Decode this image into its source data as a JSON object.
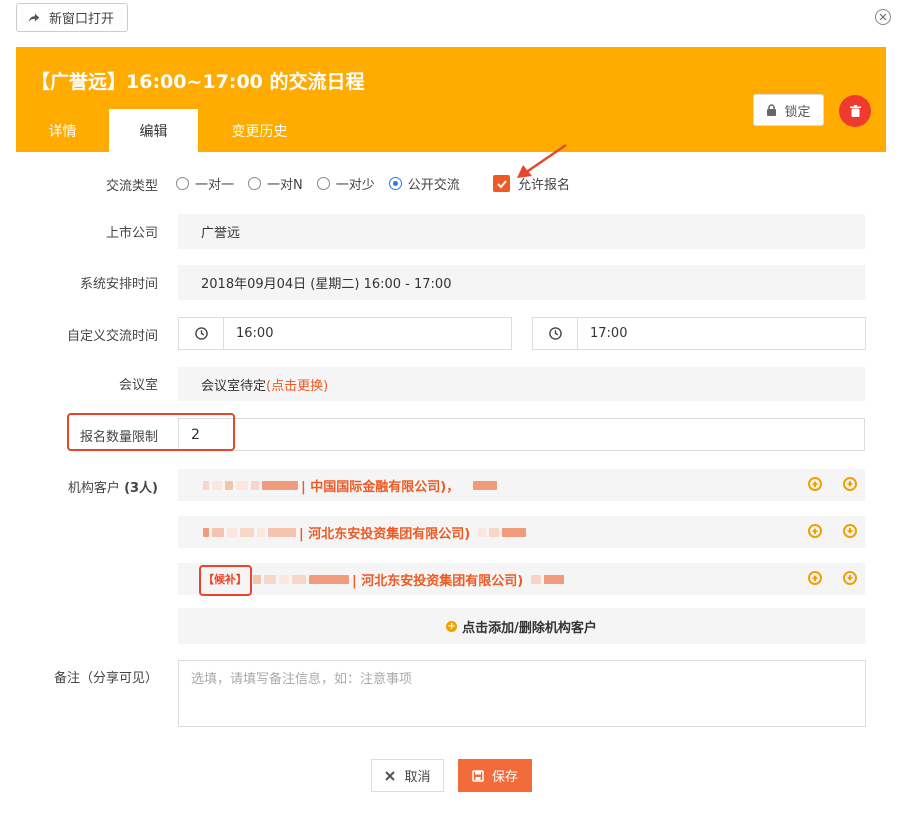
{
  "toolbar": {
    "new_window_label": "新窗口打开"
  },
  "header": {
    "title": "【广誉远】16:00~17:00 的交流日程",
    "tabs": [
      {
        "label": "详情"
      },
      {
        "label": "编辑"
      },
      {
        "label": "变更历史"
      }
    ],
    "lock_label": "锁定"
  },
  "form": {
    "exchange_type": {
      "label": "交流类型",
      "options": [
        "一对一",
        "一对N",
        "一对少",
        "公开交流"
      ],
      "selected": "公开交流",
      "allow_signup_label": "允许报名",
      "allow_signup_checked": true
    },
    "company": {
      "label": "上市公司",
      "value": "广誉远"
    },
    "system_time": {
      "label": "系统安排时间",
      "value": "2018年09月04日 (星期二)  16:00 - 17:00"
    },
    "custom_time": {
      "label": "自定义交流时间",
      "start": "16:00",
      "end": "17:00"
    },
    "room": {
      "label": "会议室",
      "value": "会议室待定",
      "change_link": "(点击更换)"
    },
    "signup_limit": {
      "label": "报名数量限制",
      "value": "2"
    },
    "clients": {
      "label": "机构客户",
      "count": "(3人)",
      "rows": [
        {
          "tag": "",
          "company": "| 中国国际金融有限公司)，"
        },
        {
          "tag": "",
          "company": "| 河北东安投资集团有限公司)"
        },
        {
          "tag": "【候补】",
          "company": "| 河北东安投资集团有限公司)"
        }
      ],
      "add_label": "点击添加/删除机构客户"
    },
    "note": {
      "label": "备注（分享可见）",
      "placeholder": "选填，请填写备注信息，如：注意事项"
    }
  },
  "actions": {
    "cancel_label": "取消",
    "save_label": "保存"
  },
  "colors": {
    "header": "#ffab00",
    "accent": "#ee5a24",
    "radio_selected": "#2f7bd9",
    "delete": "#ef3b2d"
  }
}
